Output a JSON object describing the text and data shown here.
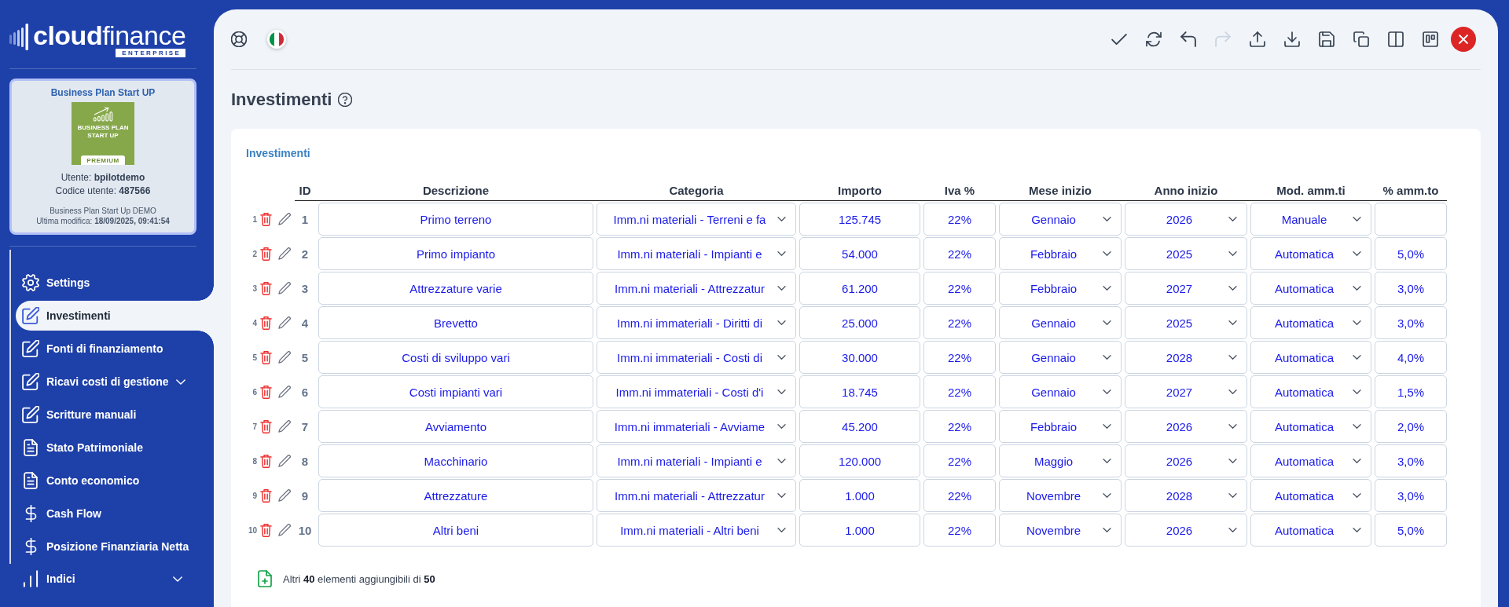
{
  "sidebar": {
    "logo": {
      "wordmark": "**cloud**finance",
      "edition": "ENTERPRISE"
    },
    "project": {
      "title": "Business Plan Start UP",
      "cover": {
        "title_lines": [
          "BUSINESS PLAN",
          "START UP"
        ],
        "tag": "PREMIUM"
      },
      "user": "Utente: **bpilotdemo**",
      "user_code": "Codice utente: **487566**",
      "plan": "Business Plan Start Up DEMO",
      "last_modified": "Ultima modifica: **18/09/2025, 09:41:54**"
    },
    "menu": [
      {
        "label": "Settings",
        "kind": "link",
        "selected": false
      },
      {
        "label": "Investimenti",
        "kind": "link",
        "selected": true
      },
      {
        "label": "Fonti di finanziamento",
        "kind": "link",
        "selected": false
      },
      {
        "label": "Ricavi costi di gestione",
        "kind": "group",
        "expanded": false,
        "selected": false
      },
      {
        "label": "Scritture manuali",
        "kind": "link",
        "selected": false
      },
      {
        "label": "Stato Patrimoniale",
        "kind": "link",
        "selected": false
      },
      {
        "label": "Conto economico",
        "kind": "link",
        "selected": false
      },
      {
        "label": "Cash Flow",
        "kind": "link",
        "selected": false
      },
      {
        "label": "Posizione Finanziaria Netta",
        "kind": "link",
        "selected": false
      },
      {
        "label": "Indici",
        "kind": "group",
        "expanded": false,
        "selected": false
      }
    ]
  },
  "toolbar": {
    "actions": [
      {
        "disabled": false
      },
      {
        "disabled": false
      },
      {
        "disabled": false
      },
      {
        "disabled": true
      },
      {
        "disabled": false
      },
      {
        "disabled": false
      },
      {
        "disabled": false
      },
      {
        "disabled": false
      },
      {
        "disabled": false
      },
      {
        "disabled": false
      }
    ]
  },
  "page": {
    "title": "Investimenti"
  },
  "section": {
    "title": "Investimenti",
    "table": {
      "columns": [
        {
          "label": "ID",
          "kind": "id"
        },
        {
          "label": "Descrizione",
          "kind": "input"
        },
        {
          "label": "Categoria",
          "kind": "select"
        },
        {
          "label": "Importo",
          "kind": "input"
        },
        {
          "label": "Iva %",
          "kind": "input"
        },
        {
          "label": "Mese inizio",
          "kind": "select"
        },
        {
          "label": "Anno inizio",
          "kind": "select"
        },
        {
          "label": "Mod. amm.ti",
          "kind": "select"
        },
        {
          "label": "% amm.to",
          "kind": "input"
        }
      ],
      "rows": [
        {
          "number": "1",
          "cells": [
            "1",
            "Primo terreno",
            "Imm.ni materiali - Terreni e fa",
            "125.745",
            "22%",
            "Gennaio",
            "2026",
            "Manuale"
          ]
        },
        {
          "number": "2",
          "cells": [
            "2",
            "Primo impianto",
            "Imm.ni materiali - Impianti e",
            "54.000",
            "22%",
            "Febbraio",
            "2025",
            "Automatica",
            "5,0%"
          ]
        },
        {
          "number": "3",
          "cells": [
            "3",
            "Attrezzature varie",
            "Imm.ni materiali - Attrezzatur",
            "61.200",
            "22%",
            "Febbraio",
            "2027",
            "Automatica",
            "3,0%"
          ]
        },
        {
          "number": "4",
          "cells": [
            "4",
            "Brevetto",
            "Imm.ni immateriali - Diritti di",
            "25.000",
            "22%",
            "Gennaio",
            "2025",
            "Automatica",
            "3,0%"
          ]
        },
        {
          "number": "5",
          "cells": [
            "5",
            "Costi di sviluppo vari",
            "Imm.ni immateriali - Costi di",
            "30.000",
            "22%",
            "Gennaio",
            "2028",
            "Automatica",
            "4,0%"
          ]
        },
        {
          "number": "6",
          "cells": [
            "6",
            "Costi impianti vari",
            "Imm.ni immateriali - Costi d'i",
            "18.745",
            "22%",
            "Gennaio",
            "2027",
            "Automatica",
            "1,5%"
          ]
        },
        {
          "number": "7",
          "cells": [
            "7",
            "Avviamento",
            "Imm.ni immateriali - Avviame",
            "45.200",
            "22%",
            "Febbraio",
            "2026",
            "Automatica",
            "2,0%"
          ]
        },
        {
          "number": "8",
          "cells": [
            "8",
            "Macchinario",
            "Imm.ni materiali - Impianti e",
            "120.000",
            "22%",
            "Maggio",
            "2026",
            "Automatica",
            "3,0%"
          ]
        },
        {
          "number": "9",
          "cells": [
            "9",
            "Attrezzature",
            "Imm.ni materiali - Attrezzatur",
            "1.000",
            "22%",
            "Novembre",
            "2028",
            "Automatica",
            "3,0%"
          ]
        },
        {
          "number": "10",
          "cells": [
            "10",
            "Altri beni",
            "Imm.ni materiali - Altri beni",
            "1.000",
            "22%",
            "Novembre",
            "2026",
            "Automatica",
            "5,0%"
          ]
        }
      ]
    },
    "footer": "Altri **40** elementi aggiungibili di **50**"
  }
}
